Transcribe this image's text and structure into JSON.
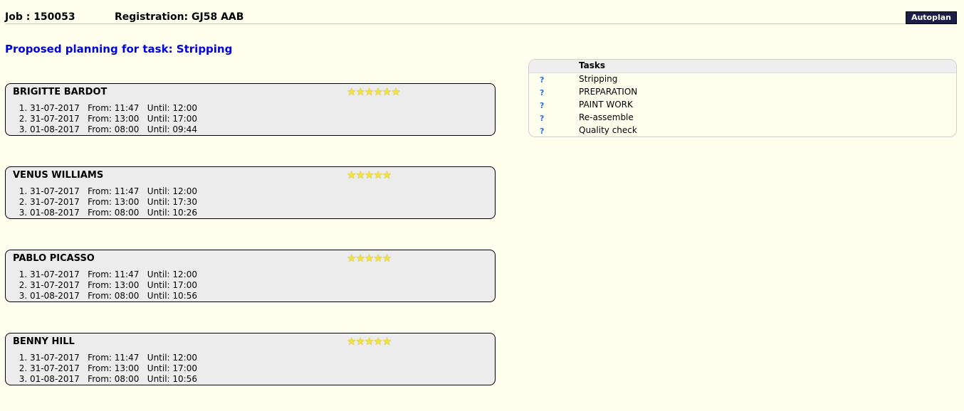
{
  "header": {
    "job": "Job : 150053",
    "registration": "Registration: GJ58 AAB",
    "autoplan_label": "Autoplan"
  },
  "proposed_title": "Proposed planning for task: Stripping",
  "mechanics": [
    {
      "name": "BRIGITTE BARDOT",
      "stars": "★★★★★★",
      "rating": 6,
      "slots": [
        "31-07-2017   From: 11:47   Until: 12:00",
        "31-07-2017   From: 13:00   Until: 17:00",
        "01-08-2017   From: 08:00   Until: 09:44"
      ]
    },
    {
      "name": "VENUS WILLIAMS",
      "stars": "★★★★★",
      "rating": 5,
      "slots": [
        "31-07-2017   From: 11:47   Until: 12:00",
        "31-07-2017   From: 13:00   Until: 17:30",
        "01-08-2017   From: 08:00   Until: 10:26"
      ]
    },
    {
      "name": "PABLO PICASSO",
      "stars": "★★★★★",
      "rating": 5,
      "slots": [
        "31-07-2017   From: 11:47   Until: 12:00",
        "31-07-2017   From: 13:00   Until: 17:00",
        "01-08-2017   From: 08:00   Until: 10:56"
      ]
    },
    {
      "name": "BENNY HILL",
      "stars": "★★★★★",
      "rating": 5,
      "slots": [
        "31-07-2017   From: 11:47   Until: 12:00",
        "31-07-2017   From: 13:00   Until: 17:00",
        "01-08-2017   From: 08:00   Until: 10:56"
      ]
    }
  ],
  "tasks": {
    "header": "Tasks",
    "items": [
      {
        "q": "?",
        "label": "Stripping"
      },
      {
        "q": "?",
        "label": "PREPARATION"
      },
      {
        "q": "?",
        "label": "PAINT WORK"
      },
      {
        "q": "?",
        "label": "Re-assemble"
      },
      {
        "q": "?",
        "label": "Quality check"
      }
    ]
  },
  "colors": {
    "background": "#ffffee",
    "title_blue": "#0000dd",
    "button_bg": "#1d1d4a",
    "star": "#f2e23c"
  }
}
